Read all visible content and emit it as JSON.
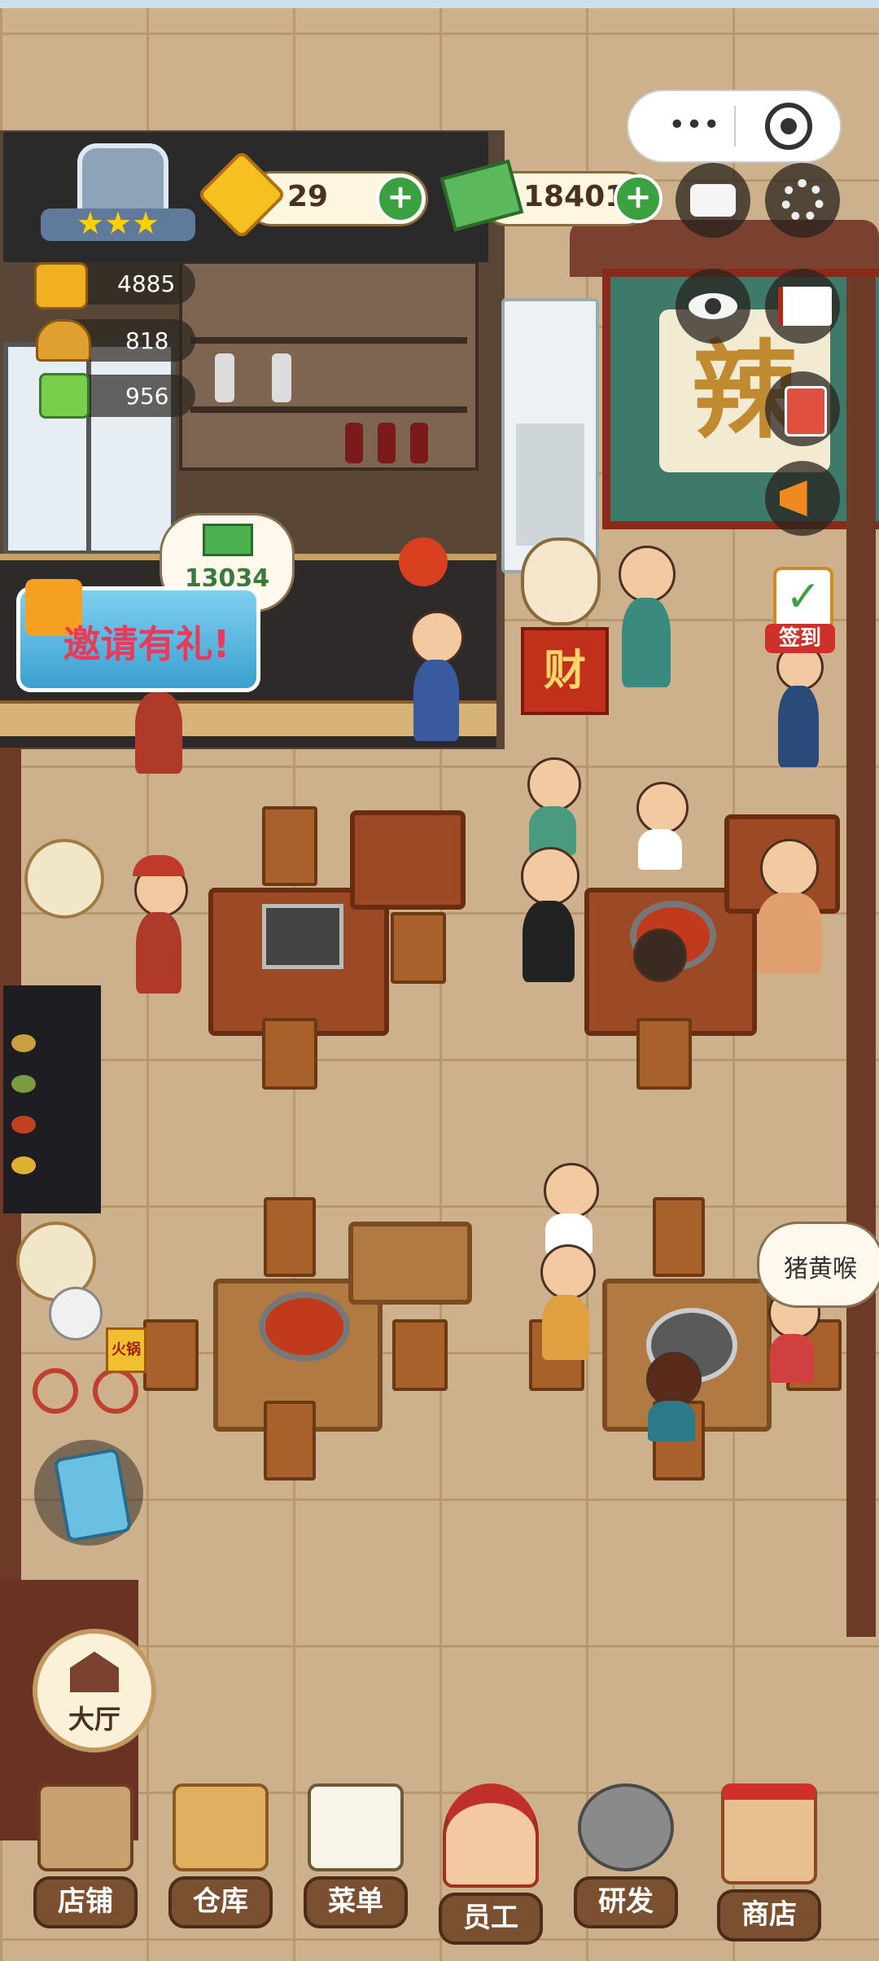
{
  "resources": {
    "gems": "29",
    "cash": "18401"
  },
  "stats": [
    {
      "icon": "hotpot-icon",
      "value": "4885"
    },
    {
      "icon": "dish-cover-icon",
      "value": "818"
    },
    {
      "icon": "cash-plate-icon",
      "value": "956"
    }
  ],
  "rank": {
    "stars": 3
  },
  "cash_bubble": "13034",
  "invite_banner": "邀请有礼!",
  "fortune_box": "财",
  "checkin_label": "签到",
  "customer_bubble": "猪黄喉",
  "shop_sign": "辣",
  "bike_sign": "火锅",
  "hall_button": "大厅",
  "bottom_nav": [
    {
      "icon": "storefront-icon",
      "label": "店铺"
    },
    {
      "icon": "boxes-icon",
      "label": "仓库"
    },
    {
      "icon": "clipboard-icon",
      "label": "菜单"
    },
    {
      "icon": "chef-icon",
      "label": "员工"
    },
    {
      "icon": "wok-icon",
      "label": "研发"
    },
    {
      "icon": "shop-icon",
      "label": "商店"
    }
  ],
  "colors": {
    "plus_green": "#3aa040",
    "nav_brown": "#7a5030",
    "invite_pink": "#e83a5a"
  }
}
